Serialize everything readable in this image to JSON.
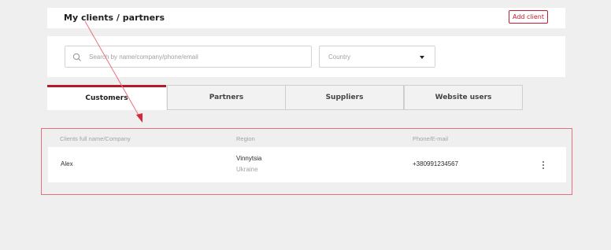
{
  "header": {
    "title": "My clients / partners",
    "add_label": "Add client"
  },
  "filters": {
    "search_placeholder": "Search by name/company/phone/email",
    "country_value": "Country"
  },
  "tabs": [
    {
      "label": "Customers",
      "active": true
    },
    {
      "label": "Partners",
      "active": false
    },
    {
      "label": "Suppliers",
      "active": false
    },
    {
      "label": "Website users",
      "active": false
    }
  ],
  "table": {
    "columns": [
      "Clients full name/Company",
      "Region",
      "Phone/E-mail"
    ],
    "rows": [
      {
        "name": "Alex",
        "region_city": "Vinnytsia",
        "region_country": "Ukraine",
        "phone": "+380991234567"
      }
    ]
  },
  "colors": {
    "accent": "#b31b2b",
    "annotation": "#e8707c"
  }
}
